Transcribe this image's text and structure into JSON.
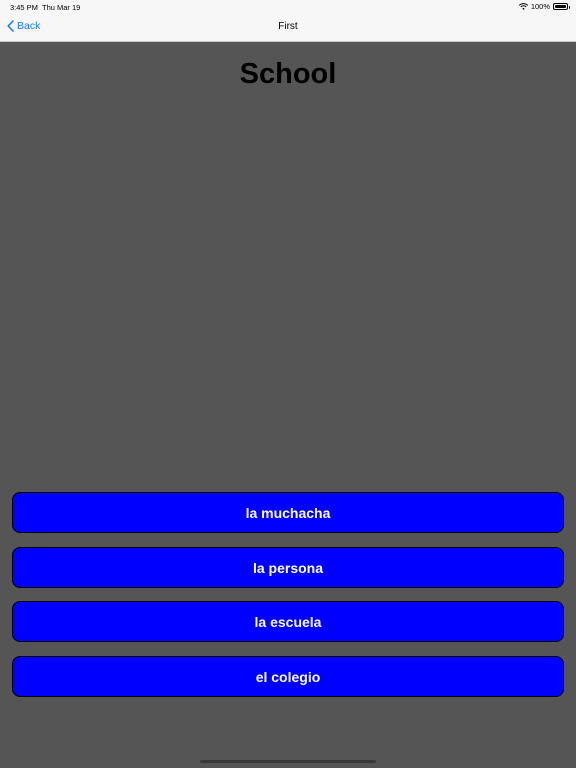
{
  "status_bar": {
    "time": "3:45 PM",
    "date": "Thu Mar 19",
    "battery": "100%",
    "battery_level": 1.0,
    "icons": [
      "wifi-icon",
      "battery-icon"
    ]
  },
  "nav": {
    "back_label": "Back",
    "title": "First",
    "back_icon": "chevron-left-icon",
    "accent_color": "#1a7cf5"
  },
  "main": {
    "title": "School"
  },
  "answers": [
    {
      "label": "la muchacha"
    },
    {
      "label": "la persona"
    },
    {
      "label": "la escuela"
    },
    {
      "label": "el colegio"
    }
  ],
  "colors": {
    "background": "#555555",
    "button": "#0000ff",
    "button_text": "#ffffff"
  }
}
